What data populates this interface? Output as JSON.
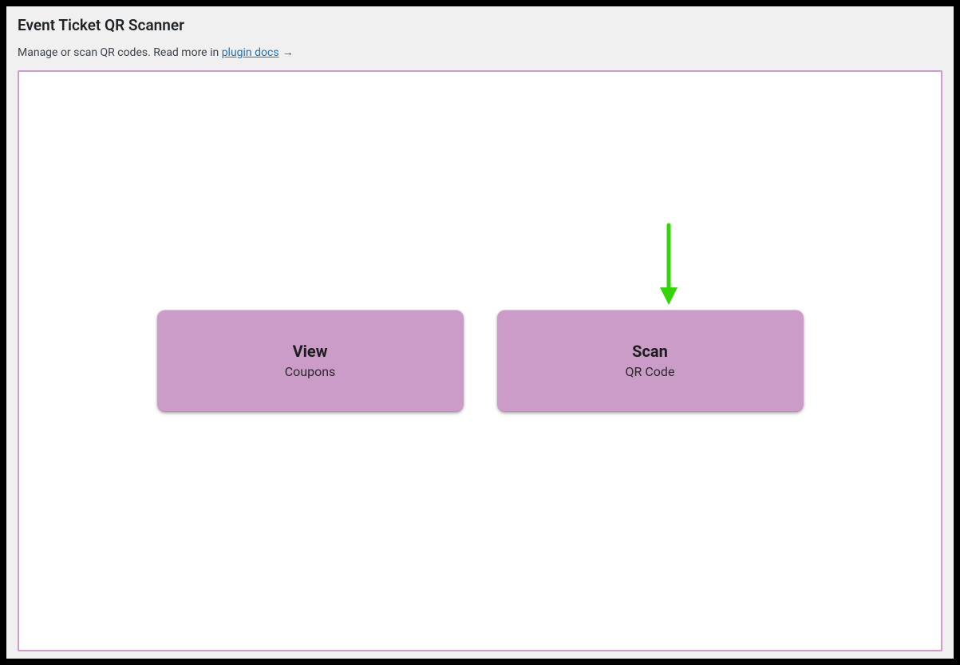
{
  "header": {
    "title": "Event Ticket QR Scanner",
    "subtitle_prefix": "Manage or scan QR codes. Read more in ",
    "link_text": "plugin docs",
    "arrow_glyph": "→"
  },
  "cards": {
    "view": {
      "title": "View",
      "subtitle": "Coupons"
    },
    "scan": {
      "title": "Scan",
      "subtitle": "QR Code"
    }
  },
  "annotation": {
    "color": "#35d40a"
  }
}
